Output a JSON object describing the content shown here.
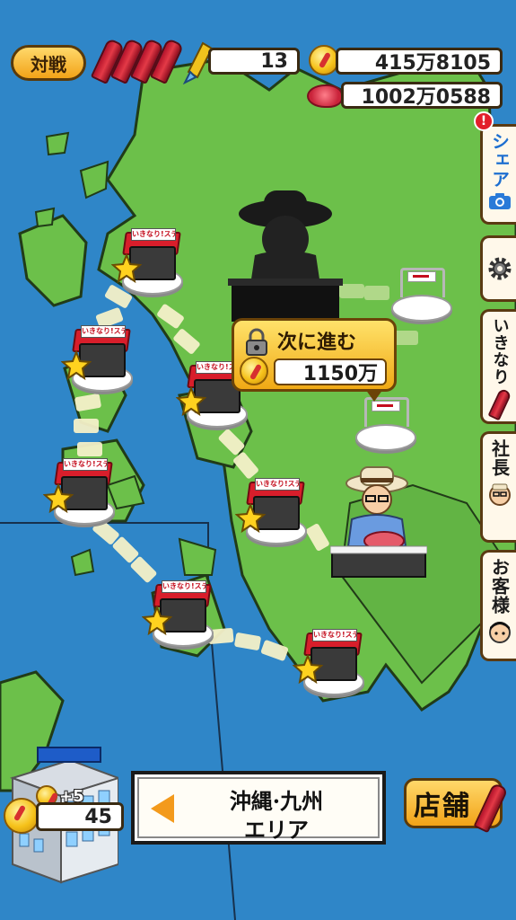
{
  "colors": {
    "sea": "#2f86c8",
    "land": "#6cc04a",
    "accent": "#f2a318",
    "path": "#f4f0c8"
  },
  "hud": {
    "battle_label": "対戦",
    "rockets_value": "13",
    "coins_value": "415万8105",
    "meat_value": "1002万0588"
  },
  "side_tabs": {
    "share_label": "シェア",
    "settings_icon": "gear-icon",
    "ikinari_label": "いきなり",
    "president_label": "社長",
    "customer_label": "お客様",
    "notification_badge": "!"
  },
  "shop_sign": "いきなり!ステーキ",
  "unlock": {
    "label": "次に進む",
    "cost": "1150万"
  },
  "bottom": {
    "income_bonus": "+5",
    "income_value": "45",
    "area_name": "沖縄·九州",
    "area_suffix": "エリア",
    "shop_button_label": "店舗"
  }
}
